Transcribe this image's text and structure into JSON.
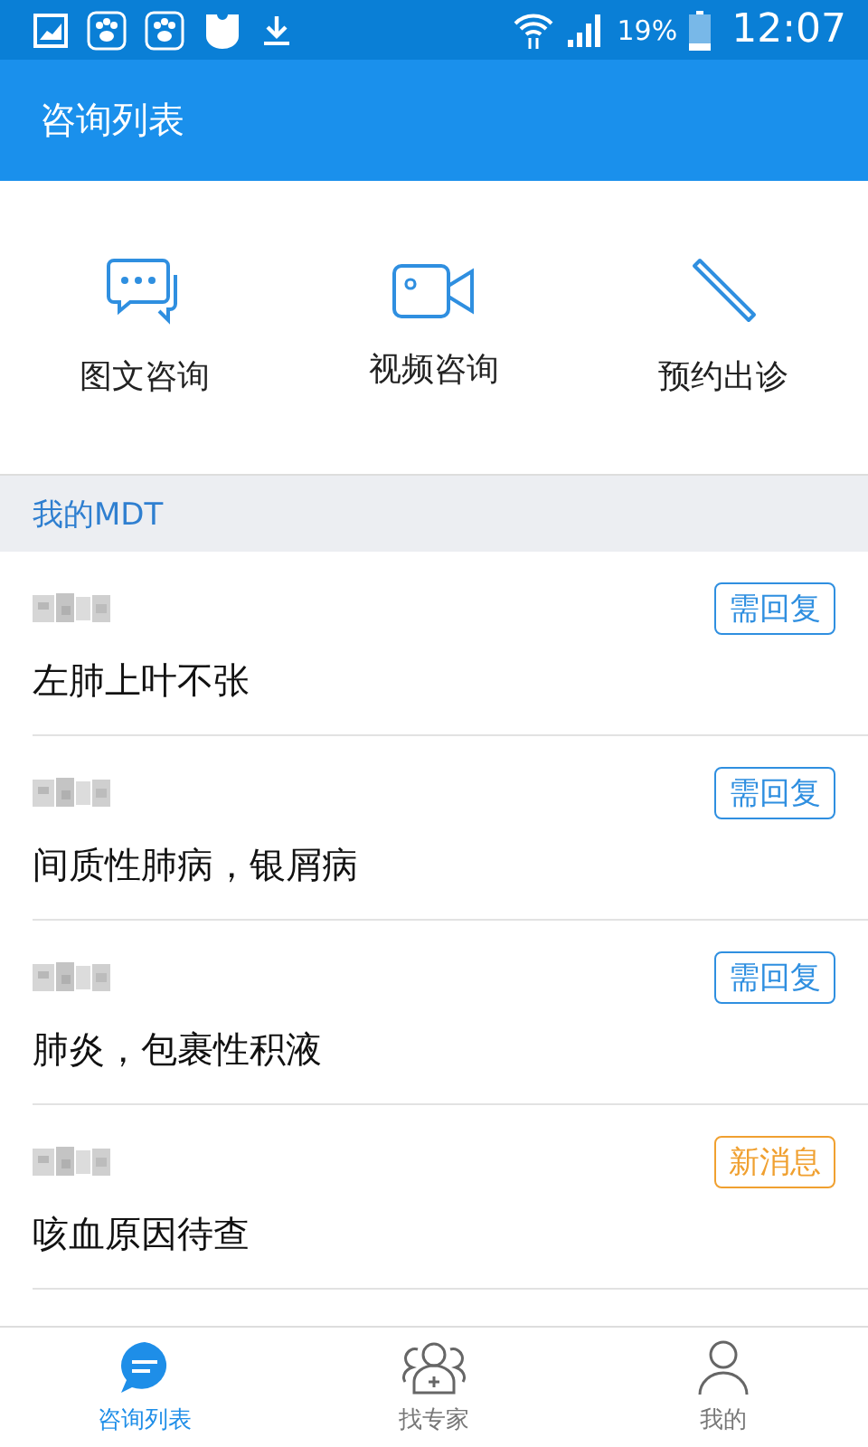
{
  "status_bar": {
    "battery": "19%",
    "time": "12:07"
  },
  "app_bar": {
    "title": "咨询列表"
  },
  "actions": [
    {
      "kind": "chat",
      "label": "图文咨询"
    },
    {
      "kind": "video",
      "label": "视频咨询"
    },
    {
      "kind": "pen",
      "label": "预约出诊"
    }
  ],
  "section": {
    "title": "我的MDT"
  },
  "consultations": [
    {
      "diagnosis": "左肺上叶不张",
      "badge": {
        "kind": "reply",
        "label": "需回复"
      }
    },
    {
      "diagnosis": "间质性肺病，银屑病",
      "badge": {
        "kind": "reply",
        "label": "需回复"
      }
    },
    {
      "diagnosis": "肺炎，包裹性积液",
      "badge": {
        "kind": "reply",
        "label": "需回复"
      }
    },
    {
      "diagnosis": "咳血原因待查",
      "badge": {
        "kind": "new",
        "label": "新消息"
      }
    }
  ],
  "bottom_nav": [
    {
      "kind": "list",
      "label": "咨询列表",
      "selected": true
    },
    {
      "kind": "experts",
      "label": "找专家",
      "selected": false
    },
    {
      "kind": "me",
      "label": "我的",
      "selected": false
    }
  ]
}
